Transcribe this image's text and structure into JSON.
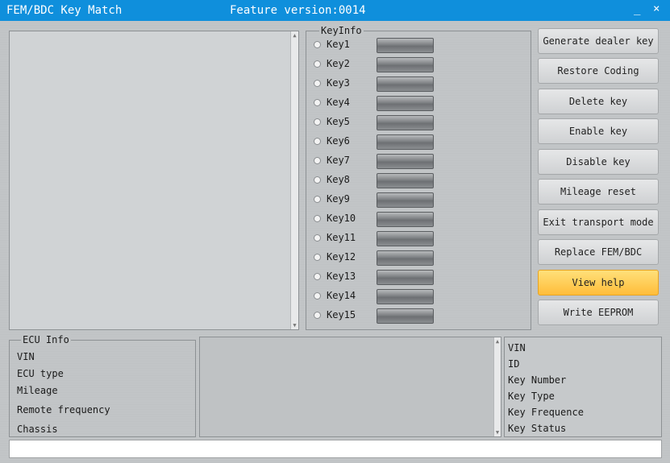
{
  "window": {
    "title": "FEM/BDC Key Match",
    "feature_version": "Feature version:0014",
    "minimize": "_",
    "close": "×"
  },
  "keyinfo": {
    "legend": "KeyInfo",
    "keys": [
      "Key1",
      "Key2",
      "Key3",
      "Key4",
      "Key5",
      "Key6",
      "Key7",
      "Key8",
      "Key9",
      "Key10",
      "Key11",
      "Key12",
      "Key13",
      "Key14",
      "Key15"
    ]
  },
  "buttons": [
    {
      "label": "Generate dealer key"
    },
    {
      "label": "Restore Coding"
    },
    {
      "label": "Delete key"
    },
    {
      "label": "Enable key"
    },
    {
      "label": "Disable key"
    },
    {
      "label": "Mileage reset"
    },
    {
      "label": "Exit transport mode"
    },
    {
      "label": "Replace FEM/BDC"
    },
    {
      "label": "View help",
      "highlighted": true
    },
    {
      "label": "Write EEPROM"
    }
  ],
  "ecu_info": {
    "legend": "ECU Info",
    "fields": [
      "VIN",
      "ECU type",
      "Mileage",
      "Remote frequency",
      "Chassis"
    ]
  },
  "key_details": {
    "fields": [
      "VIN",
      "ID",
      "Key Number",
      "Key Type",
      "Key Frequence",
      "Key Status"
    ]
  },
  "colors": {
    "titlebar": "#0f8fdc",
    "highlight_button": "#ffc94d"
  }
}
